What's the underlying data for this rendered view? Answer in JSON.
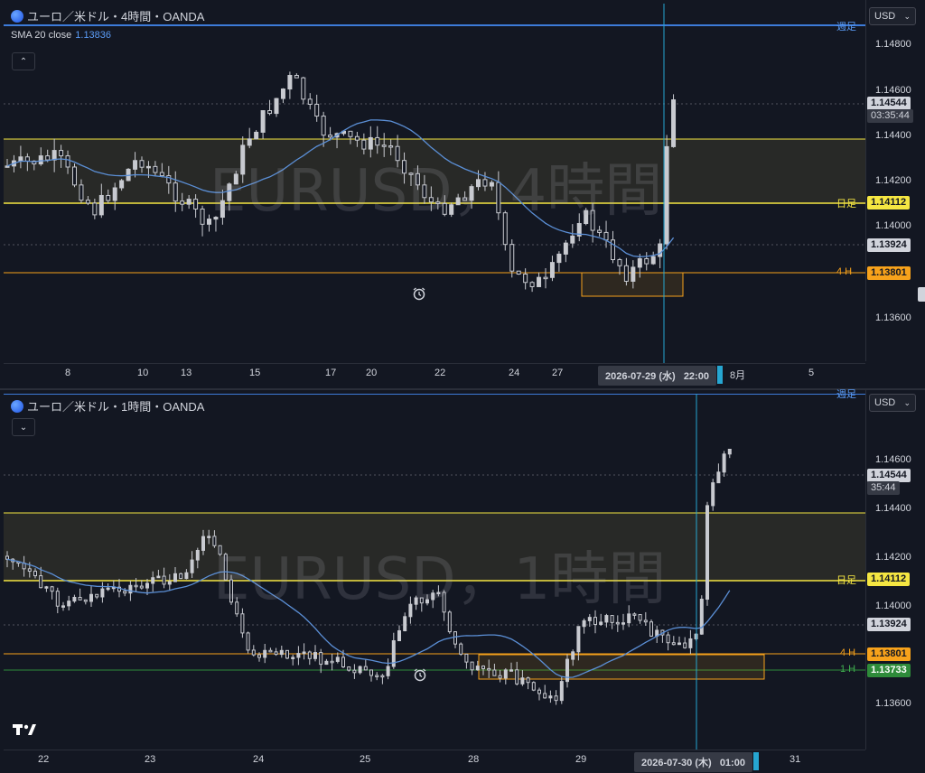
{
  "top_chart": {
    "title": "ユーロ／米ドル・4時間・OANDA",
    "sma_label": "SMA 20 close",
    "sma_value": "1.13836",
    "watermark": "EURUSD，4時間",
    "currency": "USD",
    "price_ticks": [
      "1.14800",
      "1.14600",
      "1.14400",
      "1.14200",
      "1.14000",
      "1.13600"
    ],
    "last_price": "1.14544",
    "countdown": "03:35:44",
    "weekly_label": "週足",
    "daily_label": "日足",
    "daily_price": "1.14112",
    "sma_tag": "1.13924",
    "h4_label": "4 H",
    "h4_price": "1.13801",
    "time_labels": [
      "8",
      "10",
      "13",
      "15",
      "17",
      "20",
      "22",
      "24",
      "27",
      "8月",
      "5"
    ],
    "crosshair_time": "2026-07-29 (水)   22:00"
  },
  "bottom_chart": {
    "title": "ユーロ／米ドル・1時間・OANDA",
    "watermark": "EURUSD，1時間",
    "currency": "USD",
    "price_ticks": [
      "1.14600",
      "1.14400",
      "1.14200",
      "1.14000",
      "1.13600"
    ],
    "last_price": "1.14544",
    "countdown": "35:44",
    "weekly_label": "週足",
    "daily_label": "日足",
    "daily_price": "1.14112",
    "sma_tag": "1.13924",
    "h4_label": "4 H",
    "h4_price": "1.13801",
    "h1_label": "1 H",
    "h1_price": "1.13733",
    "time_labels": [
      "22",
      "23",
      "24",
      "25",
      "28",
      "29",
      "31"
    ],
    "crosshair_time": "2026-07-30 (木)   01:00"
  },
  "colors": {
    "background": "#131722",
    "candle": "#c8cad0",
    "sma": "#5b8fd6",
    "daily_line": "#f5e642",
    "h4_line": "#f7a21b",
    "h1_line": "#2e8b3a",
    "crosshair": "#26a6d1",
    "weekly_line": "#3d7bd9"
  },
  "icons": {
    "symbol": "eurusd-flag-icon",
    "collapse": "chevron-icon",
    "alarm": "alarm-clock-icon",
    "logo": "tradingview-logo"
  }
}
